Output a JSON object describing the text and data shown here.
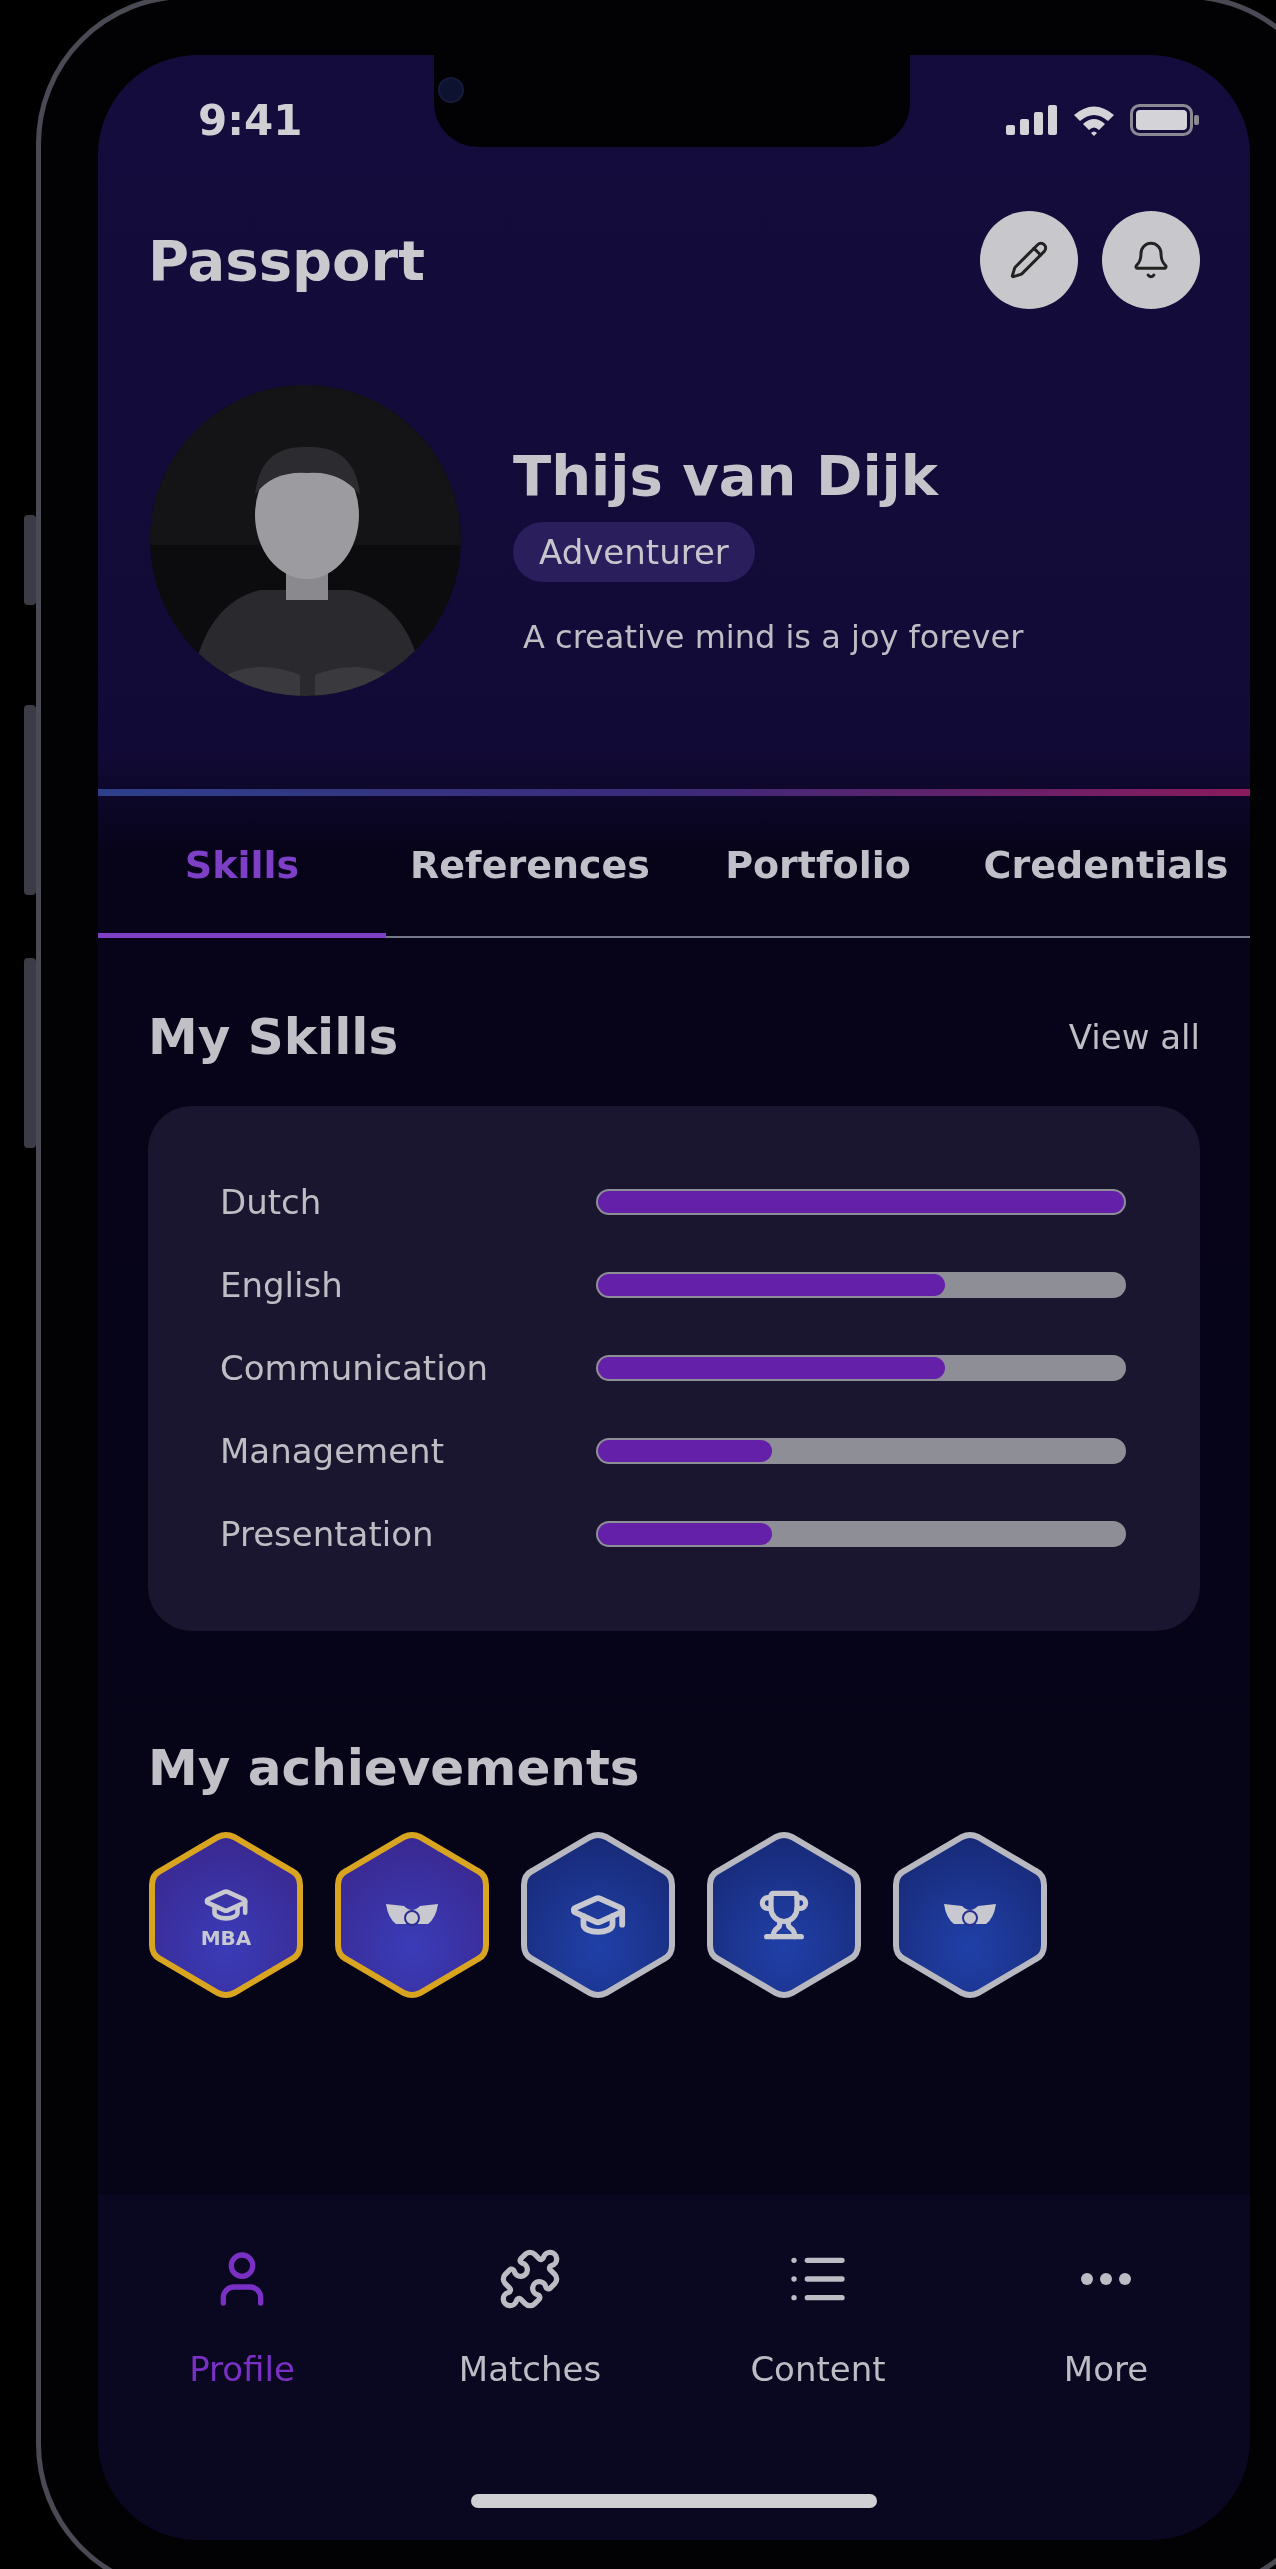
{
  "status_bar": {
    "time": "9:41"
  },
  "header": {
    "title": "Passport",
    "actions": [
      {
        "kind": "edit"
      },
      {
        "kind": "notifications"
      }
    ]
  },
  "profile": {
    "name": "Thijs van Dijk",
    "tag": "Adventurer",
    "bio": "A creative mind is a joy forever"
  },
  "tabs": [
    {
      "label": "Skills",
      "selected": true
    },
    {
      "label": "References",
      "selected": false
    },
    {
      "label": "Portfolio",
      "selected": false
    },
    {
      "label": "Credentials",
      "selected": false
    }
  ],
  "skills": {
    "title": "My Skills",
    "link": "View all",
    "items": [
      {
        "name": "Dutch",
        "level": 1
      },
      {
        "name": "English",
        "level": 0.66
      },
      {
        "name": "Communication",
        "level": 0.66
      },
      {
        "name": "Management",
        "level": 0.33
      },
      {
        "name": "Presentation",
        "level": 0.33
      }
    ]
  },
  "achievements": {
    "title": "My achievements",
    "badges": [
      {
        "kind": "mba",
        "label": "MBA",
        "color": "#d9a521"
      },
      {
        "kind": "mask",
        "color": "#d9a521"
      },
      {
        "kind": "cap",
        "color": "#b8b8c0"
      },
      {
        "kind": "trophy",
        "color": "#b8b8c0"
      },
      {
        "kind": "mask",
        "color": "#b8b8c0"
      }
    ]
  },
  "nav": [
    {
      "label": "Profile",
      "kind": "user",
      "selected": true
    },
    {
      "label": "Matches",
      "kind": "puzzle",
      "selected": false
    },
    {
      "label": "Content",
      "kind": "list",
      "selected": false
    },
    {
      "label": "More",
      "kind": "more",
      "selected": false
    }
  ]
}
